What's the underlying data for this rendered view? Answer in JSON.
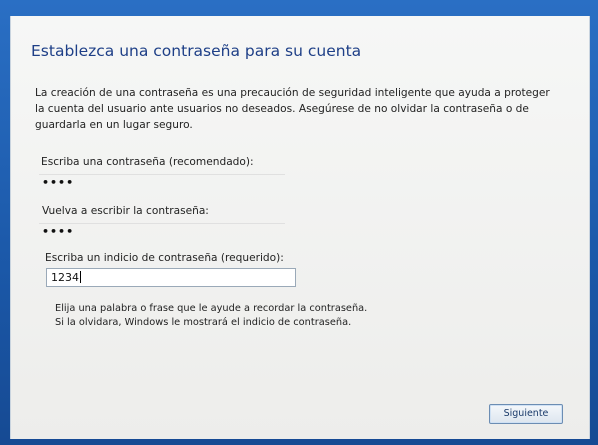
{
  "dialog": {
    "title": "Establezca una contraseña para su cuenta",
    "intro_line1": "La creación de una contraseña es una precaución de seguridad inteligente que ayuda a proteger",
    "intro_line2": "la cuenta del usuario ante usuarios no deseados. Asegúrese de no olvidar la contraseña o de",
    "intro_line3": "guardarla en un lugar seguro."
  },
  "fields": {
    "password_label": "Escriba una contraseña (recomendado):",
    "password_value": "••••",
    "confirm_label": "Vuelva a escribir la contraseña:",
    "confirm_value": "••••",
    "hint_label": "Escriba un indicio de contraseña (requerido):",
    "hint_value": "1234"
  },
  "note": {
    "line1": "Elija una palabra o frase que le ayude a recordar la contraseña.",
    "line2": "Si la olvidara, Windows le mostrará el indicio de contraseña."
  },
  "buttons": {
    "next_label": "Siguiente"
  }
}
